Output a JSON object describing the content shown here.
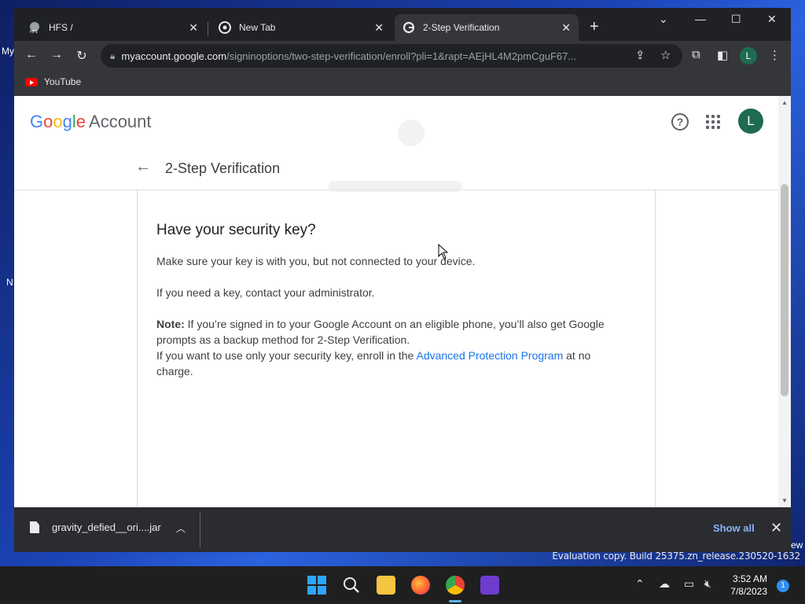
{
  "desktop": {
    "labels": [
      "My",
      "N"
    ],
    "eval_text": "Evaluation copy. Build 25375.zn_release.230520-1632",
    "partial_text": "ew"
  },
  "browser": {
    "tabs": [
      {
        "title": "HFS /",
        "favicon": "hfs-icon",
        "active": false
      },
      {
        "title": "New Tab",
        "favicon": "chrome-icon",
        "active": false
      },
      {
        "title": "2-Step Verification",
        "favicon": "google-g-icon",
        "active": true
      }
    ],
    "url": {
      "host": "myaccount.google.com",
      "path": "/signinoptions/two-step-verification/enroll?pli=1&rapt=AEjHL4M2pmCguF67..."
    },
    "profile_initial": "L",
    "bookmarks": [
      {
        "label": "YouTube",
        "icon": "youtube-icon"
      }
    ]
  },
  "page": {
    "logo": {
      "letters": [
        "G",
        "o",
        "o",
        "g",
        "l",
        "e"
      ],
      "suffix": "Account"
    },
    "avatar_initial": "L",
    "title": "2-Step Verification",
    "heading": "Have your security key?",
    "para1": "Make sure your key is with you, but not connected to your device.",
    "para2": "If you need a key, contact your administrator.",
    "note_label": "Note:",
    "note_text1": "If you’re signed in to your Google Account on an eligible phone, you’ll also get Google prompts as a backup method for 2-Step Verification.",
    "note_text2_before": "If you want to use only your security key, enroll in the",
    "note_link": "Advanced Protection Program",
    "note_text2_after": "at no charge."
  },
  "download_bar": {
    "filename": "gravity_defied__ori....jar",
    "show_all": "Show all"
  },
  "taskbar": {
    "time": "3:52 AM",
    "date": "7/8/2023",
    "notification_count": "1"
  },
  "colors": {
    "accent_link": "#1a73e8",
    "avatar_bg": "#1e6b52",
    "show_all": "#8ab4f8"
  }
}
